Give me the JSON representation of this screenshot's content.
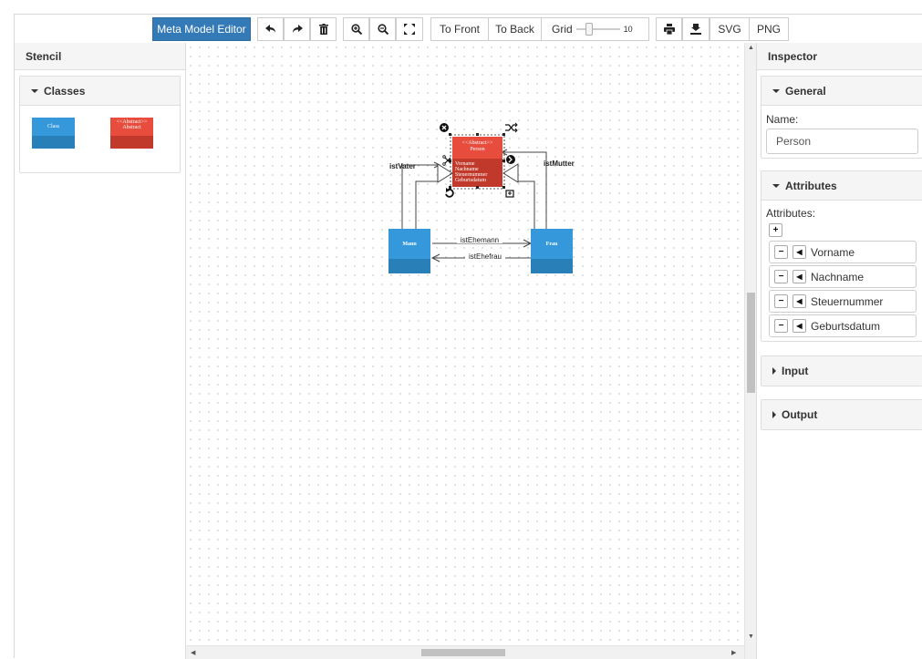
{
  "toolbar": {
    "meta_model_editor": "Meta Model Editor",
    "to_front": "To Front",
    "to_back": "To Back",
    "grid_label": "Grid",
    "grid_value": "10",
    "svg": "SVG",
    "png": "PNG"
  },
  "stencil": {
    "title": "Stencil",
    "group_title": "Classes",
    "class_item_label": "Class",
    "abstract_item_label_1": "<<Abstract>>",
    "abstract_item_label_2": "Abstract"
  },
  "canvas": {
    "person_stereotype": "<<Abstract>>",
    "person_name": "Person",
    "person_attributes": [
      "Vorname",
      "Nachname",
      "Steuernummer",
      "Geburtsdatum"
    ],
    "mann_label": "Mann",
    "frau_label": "Frau",
    "link_ist_vater": "istVater",
    "link_ist_mutter": "istMutter",
    "link_ist_ehemann": "istEhemann",
    "link_ist_ehefrau": "istEhefrau"
  },
  "inspector": {
    "title": "Inspector",
    "general_title": "General",
    "name_label": "Name:",
    "name_value": "Person",
    "attributes_title": "Attributes",
    "attributes_label": "Attributes:",
    "attributes": [
      "Vorname",
      "Nachname",
      "Steuernummer",
      "Geburtsdatum"
    ],
    "input_title": "Input",
    "output_title": "Output"
  },
  "colors": {
    "primary_button": "#337ab7",
    "class_blue": "#3498db",
    "class_blue_dark": "#2980b9",
    "abstract_red": "#e74c3c",
    "abstract_red_dark": "#c0392b"
  }
}
